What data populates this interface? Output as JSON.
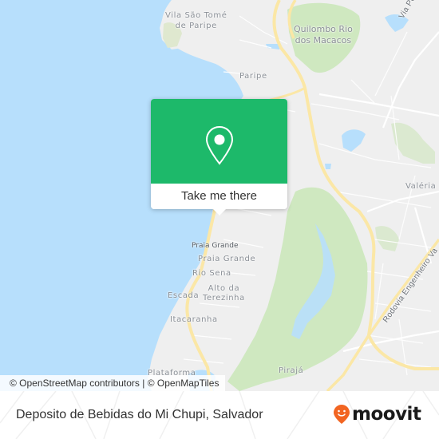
{
  "map": {
    "labels": {
      "vila_sao_tome": "Vila São Tomé\nde Paripe",
      "vila_sao_tome_l1": "Vila São Tomé",
      "vila_sao_tome_l2": "de Paripe",
      "quilombo_l1": "Quilombo Rio",
      "quilombo_l2": "dos Macacos",
      "via_periferica": "Via Periférica",
      "paripe": "Paripe",
      "valeria": "Valéria",
      "praia_grande_small": "Praia Grande",
      "praia_grande": "Praia Grande",
      "rio_sena": "Rio Sena",
      "alto_l1": "Alto da",
      "alto_l2": "Terezinha",
      "escada": "Escada",
      "itacaranha": "Itacaranha",
      "plataforma": "Plataforma",
      "piraja": "Pirajá",
      "rodovia": "Rodovia Engenheiro Va"
    },
    "colors": {
      "water": "#b7dffc",
      "land": "#efefef",
      "park": "#cfe8c0",
      "highway": "#fbe7a6"
    }
  },
  "popup": {
    "icon": "map-pin-icon",
    "action_label": "Take me there",
    "accent": "#1db96a"
  },
  "attribution": "© OpenStreetMap contributors | © OpenMapTiles",
  "footer": {
    "place_name": "Deposito de Bebidas do Mi Chupi, Salvador",
    "brand": "moovit",
    "brand_color": "#f26522"
  }
}
